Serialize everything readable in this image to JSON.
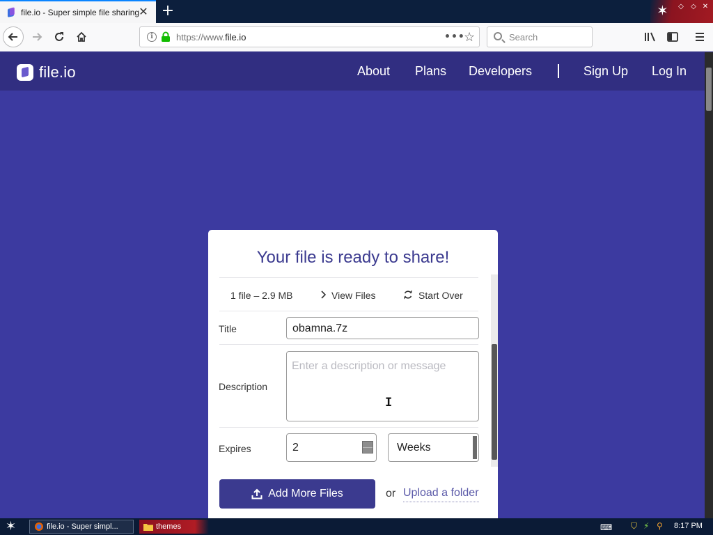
{
  "browser": {
    "tab_title": "file.io - Super simple file sharing",
    "url_prefix": "https://www.",
    "url_host": "file.io",
    "search_placeholder": "Search"
  },
  "site": {
    "logo_text": "file.io",
    "nav": {
      "about": "About",
      "plans": "Plans",
      "developers": "Developers",
      "signup": "Sign Up",
      "login": "Log In"
    }
  },
  "card": {
    "title": "Your file is ready to share!",
    "file_info": "1 file – 2.9 MB",
    "view_files": "View Files",
    "start_over": "Start Over",
    "title_label": "Title",
    "title_value": "obamna.7z",
    "description_label": "Description",
    "description_placeholder": "Enter a description or message",
    "expires_label": "Expires",
    "expires_value": "2",
    "expires_unit": "Weeks",
    "add_more_label": "Add More Files",
    "or_text": "or",
    "upload_folder_label": "Upload a folder"
  },
  "taskbar": {
    "firefox_item": "file.io - Super simpl...",
    "themes_item": "themes",
    "clock": "8:17 PM"
  },
  "colors": {
    "page_bg": "#3c3aa0",
    "header_bg": "#312e81",
    "accent": "#3b3a8f"
  }
}
